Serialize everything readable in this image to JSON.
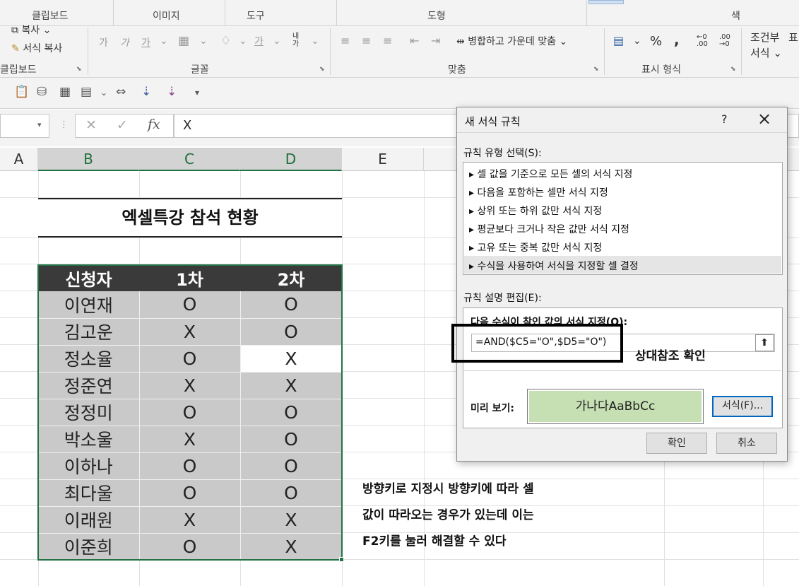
{
  "ribbon": {
    "top_groups": [
      "클립보드",
      "이미지",
      "도구",
      "도형",
      "색"
    ],
    "clipboard": {
      "copy": "복사",
      "format_painter": "서식 복사",
      "label": "클립보드"
    },
    "font": {
      "label": "글꼴",
      "btn1": "가",
      "btn2": "가",
      "btn3": "가"
    },
    "alignment": {
      "merge_center": "병합하고 가운데 맞춤",
      "label": "맞춤"
    },
    "number": {
      "percent": "%",
      "comma": ",",
      "label": "표시 형식"
    },
    "styles": {
      "cond1": "조건부",
      "cond2": "서식"
    }
  },
  "formula_bar": {
    "value": "X"
  },
  "columns": [
    "A",
    "B",
    "C",
    "D",
    "E"
  ],
  "sheet": {
    "title": "엑셀특강 참석 현황",
    "headers": [
      "신청자",
      "1차",
      "2차"
    ],
    "rows": [
      [
        "이연재",
        "O",
        "O"
      ],
      [
        "김고운",
        "X",
        "O"
      ],
      [
        "정소율",
        "O",
        "X"
      ],
      [
        "정준연",
        "X",
        "X"
      ],
      [
        "정정미",
        "O",
        "O"
      ],
      [
        "박소울",
        "X",
        "O"
      ],
      [
        "이하나",
        "O",
        "O"
      ],
      [
        "최다울",
        "O",
        "O"
      ],
      [
        "이래원",
        "X",
        "X"
      ],
      [
        "이준희",
        "O",
        "X"
      ]
    ]
  },
  "note": {
    "line1": "방향키로 지정시 방향키에 따라 셀",
    "line2": "값이 따라오는 경우가 있는데 이는",
    "line3": "F2키를 눌러 해결할 수 있다"
  },
  "dialog": {
    "title": "새 서식 규칙",
    "help": "?",
    "rule_type_label": "규칙 유형 선택(S):",
    "rules": [
      "▸ 셀 값을 기준으로 모든 셀의 서식 지정",
      "▸ 다음을 포함하는 셀만 서식 지정",
      "▸ 상위 또는 하위 값만 서식 지정",
      "▸ 평균보다 크거나 작은 값만 서식 지정",
      "▸ 고유 또는 중복 값만 서식 지정",
      "▸ 수식을 사용하여 서식을 지정할 셀 결정"
    ],
    "rule_desc_label": "규칙 설명 편집(E):",
    "formula_label": "다음 수식이 참인 값의 서식 지정(O):",
    "formula": "=AND($C5=\"O\",$D5=\"O\")",
    "preview_label": "미리 보기:",
    "preview_text": "가나다AaBbCc",
    "preview_color": "#c6e0b4",
    "format_button": "서식(F)...",
    "ok_button": "확인",
    "cancel_button": "취소"
  },
  "callout": {
    "text": "상대참조 확인"
  }
}
